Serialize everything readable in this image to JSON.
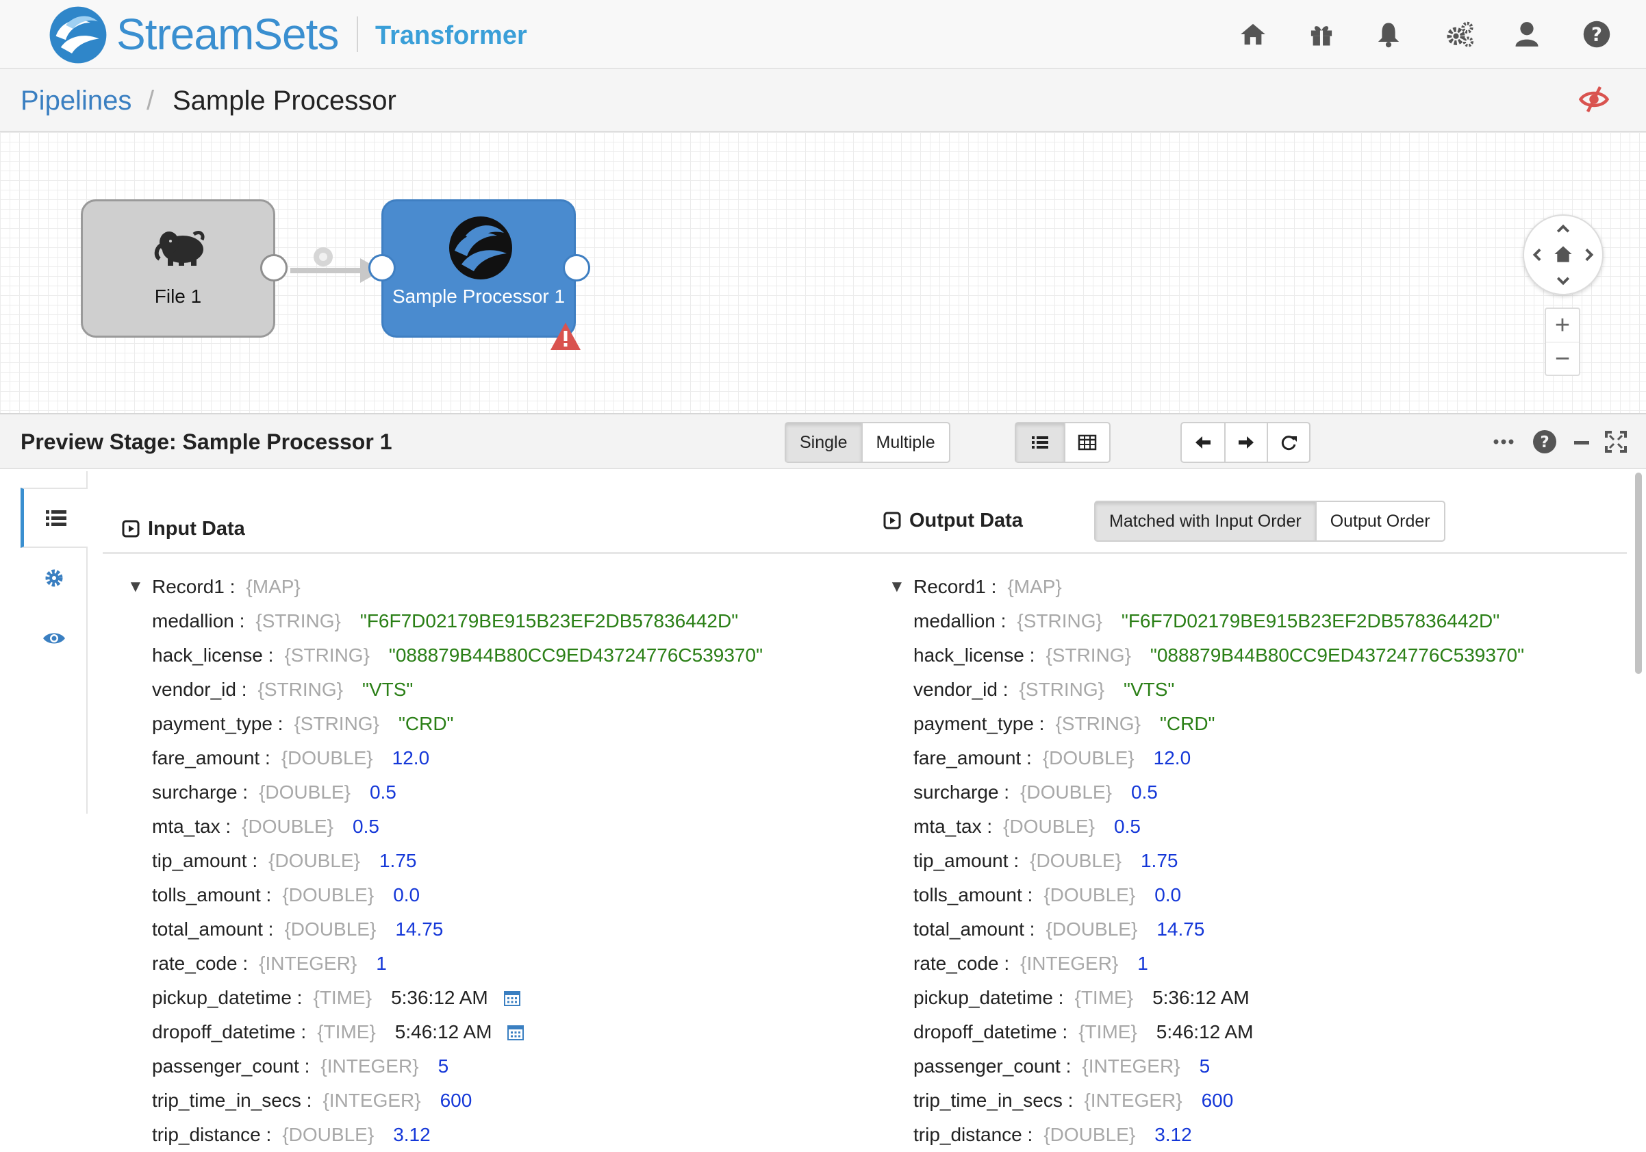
{
  "header": {
    "brand": "StreamSets",
    "product": "Transformer",
    "icons": [
      "home-icon",
      "gift-icon",
      "bell-icon",
      "gears-icon",
      "user-icon",
      "help-icon"
    ]
  },
  "breadcrumb": {
    "root": "Pipelines",
    "separator": "/",
    "current": "Sample Processor"
  },
  "canvas": {
    "stages": [
      {
        "label": "File 1",
        "icon": "hadoop-elephant-icon"
      },
      {
        "label": "Sample Processor 1",
        "icon": "streamsets-logo-icon",
        "warning": true
      }
    ],
    "zoom": {
      "in": "+",
      "out": "−"
    }
  },
  "preview": {
    "title": "Preview Stage: Sample Processor 1",
    "mode_buttons": [
      "Single",
      "Multiple"
    ],
    "active_mode": "Single",
    "view_icons": [
      "list-view-icon",
      "table-view-icon"
    ],
    "nav_icons": [
      "arrow-left-icon",
      "arrow-right-icon",
      "refresh-icon"
    ]
  },
  "input": {
    "title": "Input Data",
    "record_name": "Record1 :",
    "record_type": "{MAP}",
    "fields": [
      {
        "name": "medallion :",
        "type": "{STRING}",
        "value": "\"F6F7D02179BE915B23EF2DB57836442D\"",
        "kind": "str"
      },
      {
        "name": "hack_license :",
        "type": "{STRING}",
        "value": "\"088879B44B80CC9ED43724776C539370\"",
        "kind": "str"
      },
      {
        "name": "vendor_id :",
        "type": "{STRING}",
        "value": "\"VTS\"",
        "kind": "str"
      },
      {
        "name": "payment_type :",
        "type": "{STRING}",
        "value": "\"CRD\"",
        "kind": "str"
      },
      {
        "name": "fare_amount :",
        "type": "{DOUBLE}",
        "value": "12.0",
        "kind": "num"
      },
      {
        "name": "surcharge :",
        "type": "{DOUBLE}",
        "value": "0.5",
        "kind": "num"
      },
      {
        "name": "mta_tax :",
        "type": "{DOUBLE}",
        "value": "0.5",
        "kind": "num"
      },
      {
        "name": "tip_amount :",
        "type": "{DOUBLE}",
        "value": "1.75",
        "kind": "num"
      },
      {
        "name": "tolls_amount :",
        "type": "{DOUBLE}",
        "value": "0.0",
        "kind": "num"
      },
      {
        "name": "total_amount :",
        "type": "{DOUBLE}",
        "value": "14.75",
        "kind": "num"
      },
      {
        "name": "rate_code :",
        "type": "{INTEGER}",
        "value": "1",
        "kind": "num"
      },
      {
        "name": "pickup_datetime :",
        "type": "{TIME}",
        "value": "5:36:12 AM",
        "kind": "time",
        "calendar": true
      },
      {
        "name": "dropoff_datetime :",
        "type": "{TIME}",
        "value": "5:46:12 AM",
        "kind": "time",
        "calendar": true
      },
      {
        "name": "passenger_count :",
        "type": "{INTEGER}",
        "value": "5",
        "kind": "num"
      },
      {
        "name": "trip_time_in_secs :",
        "type": "{INTEGER}",
        "value": "600",
        "kind": "num"
      },
      {
        "name": "trip_distance :",
        "type": "{DOUBLE}",
        "value": "3.12",
        "kind": "num"
      }
    ]
  },
  "output": {
    "title": "Output Data",
    "order_buttons": [
      "Matched with Input Order",
      "Output Order"
    ],
    "active_order": "Matched with Input Order",
    "record_name": "Record1 :",
    "record_type": "{MAP}",
    "fields": [
      {
        "name": "medallion :",
        "type": "{STRING}",
        "value": "\"F6F7D02179BE915B23EF2DB57836442D\"",
        "kind": "str"
      },
      {
        "name": "hack_license :",
        "type": "{STRING}",
        "value": "\"088879B44B80CC9ED43724776C539370\"",
        "kind": "str"
      },
      {
        "name": "vendor_id :",
        "type": "{STRING}",
        "value": "\"VTS\"",
        "kind": "str"
      },
      {
        "name": "payment_type :",
        "type": "{STRING}",
        "value": "\"CRD\"",
        "kind": "str"
      },
      {
        "name": "fare_amount :",
        "type": "{DOUBLE}",
        "value": "12.0",
        "kind": "num"
      },
      {
        "name": "surcharge :",
        "type": "{DOUBLE}",
        "value": "0.5",
        "kind": "num"
      },
      {
        "name": "mta_tax :",
        "type": "{DOUBLE}",
        "value": "0.5",
        "kind": "num"
      },
      {
        "name": "tip_amount :",
        "type": "{DOUBLE}",
        "value": "1.75",
        "kind": "num"
      },
      {
        "name": "tolls_amount :",
        "type": "{DOUBLE}",
        "value": "0.0",
        "kind": "num"
      },
      {
        "name": "total_amount :",
        "type": "{DOUBLE}",
        "value": "14.75",
        "kind": "num"
      },
      {
        "name": "rate_code :",
        "type": "{INTEGER}",
        "value": "1",
        "kind": "num"
      },
      {
        "name": "pickup_datetime :",
        "type": "{TIME}",
        "value": "5:36:12 AM",
        "kind": "time"
      },
      {
        "name": "dropoff_datetime :",
        "type": "{TIME}",
        "value": "5:46:12 AM",
        "kind": "time"
      },
      {
        "name": "passenger_count :",
        "type": "{INTEGER}",
        "value": "5",
        "kind": "num"
      },
      {
        "name": "trip_time_in_secs :",
        "type": "{INTEGER}",
        "value": "600",
        "kind": "num"
      },
      {
        "name": "trip_distance :",
        "type": "{DOUBLE}",
        "value": "3.12",
        "kind": "num"
      }
    ]
  },
  "colors": {
    "brand_blue": "#3a8fd0",
    "stage_blue": "#4a8bcf",
    "string_value": "#2a7f16",
    "number_value": "#1437d8",
    "type_gray": "#a8a8a8",
    "warning_red": "#d9534f"
  }
}
